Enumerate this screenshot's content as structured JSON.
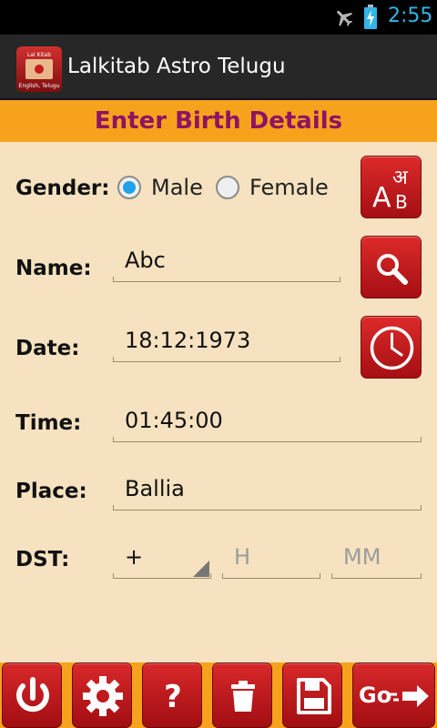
{
  "status_bar": {
    "time": "2:55",
    "icons": [
      "airplane-mode-icon",
      "battery-charging-icon"
    ]
  },
  "app": {
    "title": "Lalkitab Astro Telugu",
    "logo_text": [
      "Lal Kitab",
      "English, Telugu"
    ]
  },
  "banner": {
    "title": "Enter Birth Details"
  },
  "form": {
    "gender": {
      "label": "Gender:",
      "options": [
        "Male",
        "Female"
      ],
      "selected": "Male"
    },
    "name": {
      "label": "Name:",
      "value": "Abc"
    },
    "date": {
      "label": "Date:",
      "value": "18:12:1973"
    },
    "time": {
      "label": "Time:",
      "value": "01:45:00"
    },
    "place": {
      "label": "Place:",
      "value": "Ballia"
    },
    "dst": {
      "label": "DST:",
      "sign": "+",
      "hour_placeholder": "H",
      "minute_placeholder": "MM"
    }
  },
  "side_buttons": {
    "language": {
      "icon": "language-toggle-icon",
      "glyphs": [
        "अ",
        "A",
        "B"
      ]
    },
    "search": {
      "icon": "search-icon"
    },
    "clock": {
      "icon": "clock-icon"
    }
  },
  "bottom_bar": {
    "buttons": [
      {
        "icon": "power-icon"
      },
      {
        "icon": "gear-icon"
      },
      {
        "icon": "help-icon",
        "text": "?"
      },
      {
        "icon": "trash-icon"
      },
      {
        "icon": "save-icon"
      },
      {
        "icon": "arrow-right-icon",
        "label": "Go"
      }
    ]
  },
  "colors": {
    "accent_red": "#c8191d",
    "banner_orange": "#f7a21d",
    "banner_text": "#8e1363",
    "form_bg": "#f6e2c0",
    "radio_blue": "#1ea1e8",
    "clock_blue": "#33b5e5"
  }
}
